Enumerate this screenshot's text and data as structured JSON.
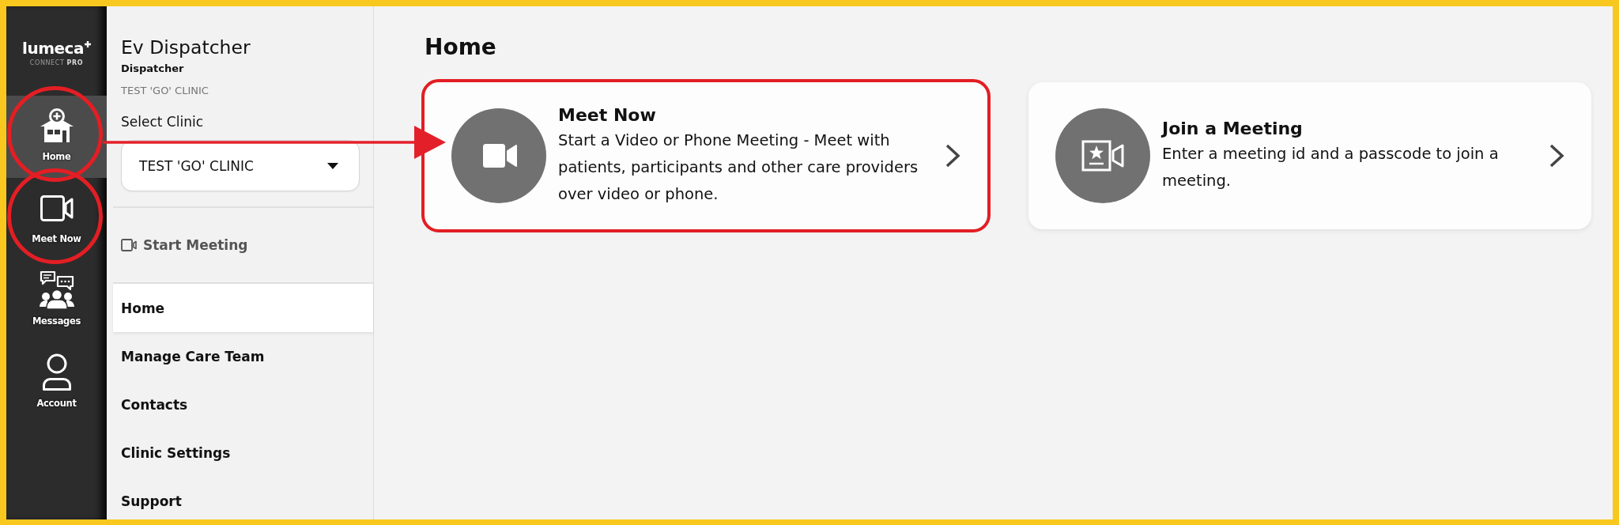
{
  "rail": {
    "logo": {
      "wordmark": "lumeca",
      "tagline": "CONNECT **PRO**"
    },
    "items": [
      {
        "kind": "home",
        "label": "Home",
        "selected": true,
        "highlighted": true
      },
      {
        "kind": "video",
        "label": "Meet Now",
        "selected": false,
        "highlighted": true
      },
      {
        "kind": "messages",
        "label": "Messages",
        "selected": false,
        "highlighted": false
      },
      {
        "kind": "account",
        "label": "Account",
        "selected": false,
        "highlighted": false
      }
    ]
  },
  "sidebar": {
    "user_name": "Ev Dispatcher",
    "role": "Dispatcher",
    "clinic": "TEST 'GO' CLINIC",
    "clinic_select": {
      "label": "Select Clinic",
      "value": "TEST 'GO' CLINIC"
    },
    "start_meeting": "Start Meeting",
    "nav": [
      {
        "label": "Home",
        "selected": true
      },
      {
        "label": "Manage Care Team",
        "selected": false
      },
      {
        "label": "Contacts",
        "selected": false
      },
      {
        "label": "Clinic Settings",
        "selected": false
      },
      {
        "label": "Support",
        "selected": false
      }
    ]
  },
  "main": {
    "title": "Home",
    "cards": [
      {
        "kind": "video",
        "title": "Meet Now",
        "description": "Start a Video or Phone Meeting - Meet with patients, participants and other care providers over video or phone.",
        "highlighted": true
      },
      {
        "kind": "join",
        "title": "Join a Meeting",
        "description": "Enter a meeting id and a passcode to join a meeting.",
        "highlighted": false
      }
    ]
  }
}
